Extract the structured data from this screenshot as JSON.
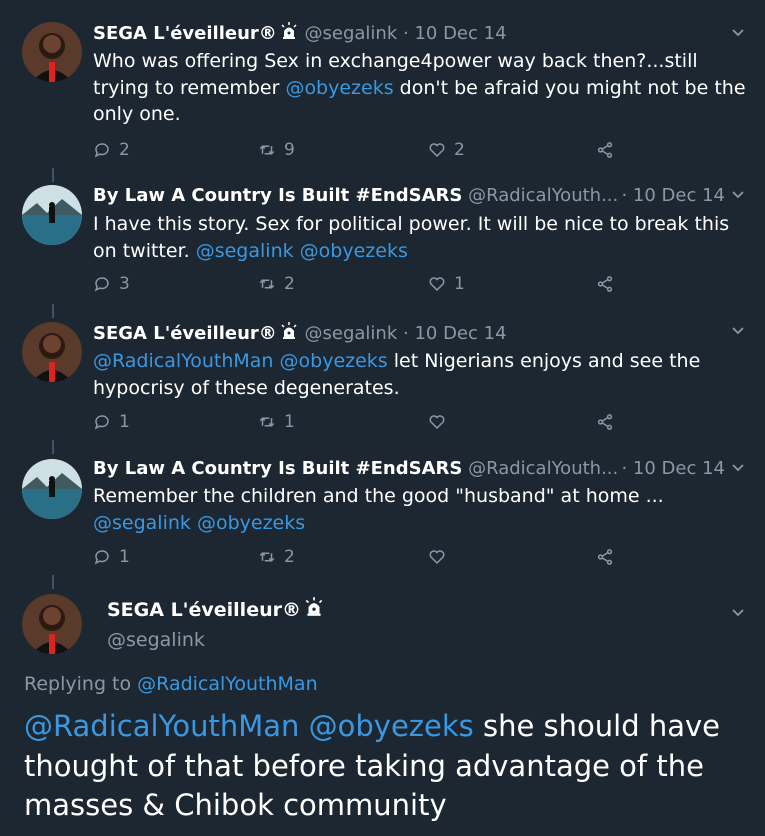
{
  "tweets": [
    {
      "name": "SEGA L'éveilleur®",
      "handle": "@segalink",
      "date": "· 10 Dec 14",
      "body": [
        {
          "t": "Who was offering Sex in exchange4power way back then?...still trying to remember "
        },
        {
          "t": "@obyezeks",
          "m": true
        },
        {
          "t": " don't be afraid you might not be the only one."
        }
      ],
      "replies": "2",
      "retweets": "9",
      "likes": "2"
    },
    {
      "name": "By Law A Country Is Built #EndSARS",
      "handle": "@RadicalYouth...",
      "date": "· 10 Dec 14",
      "body": [
        {
          "t": "I have this story. Sex for political power. It will be nice to break this on twitter.  "
        },
        {
          "t": "@segalink",
          "m": true
        },
        {
          "t": " "
        },
        {
          "t": "@obyezeks",
          "m": true
        }
      ],
      "replies": "3",
      "retweets": "2",
      "likes": "1"
    },
    {
      "name": "SEGA L'éveilleur®",
      "handle": "@segalink",
      "date": "· 10 Dec 14",
      "body": [
        {
          "t": "@RadicalYouthMan",
          "m": true
        },
        {
          "t": " "
        },
        {
          "t": "@obyezeks",
          "m": true
        },
        {
          "t": " let Nigerians enjoys and see the hypocrisy of these degenerates."
        }
      ],
      "replies": "1",
      "retweets": "1",
      "likes": ""
    },
    {
      "name": "By Law A Country Is Built #EndSARS",
      "handle": "@RadicalYouth...",
      "date": "· 10 Dec 14",
      "body": [
        {
          "t": "Remember the children and the good \"husband\" at home ... "
        },
        {
          "t": "@segalink",
          "m": true
        },
        {
          "t": " "
        },
        {
          "t": "@obyezeks",
          "m": true
        }
      ],
      "replies": "1",
      "retweets": "2",
      "likes": ""
    }
  ],
  "main_tweet": {
    "name": "SEGA L'éveilleur®",
    "handle": "@segalink",
    "replying_prefix": "Replying to ",
    "replying_to": "@RadicalYouthMan",
    "body": [
      {
        "t": "@RadicalYouthMan",
        "m": true
      },
      {
        "t": " "
      },
      {
        "t": "@obyezeks",
        "m": true
      },
      {
        "t": " she should have thought of that before taking advantage of the masses & Chibok community"
      }
    ]
  },
  "colors": {
    "background": "#1c2732",
    "mention": "#3b98e0",
    "muted": "#8899a6"
  },
  "icons": [
    "reply-icon",
    "retweet-icon",
    "like-icon",
    "share-icon",
    "chevron-down-icon",
    "alarm-emoji-icon"
  ]
}
